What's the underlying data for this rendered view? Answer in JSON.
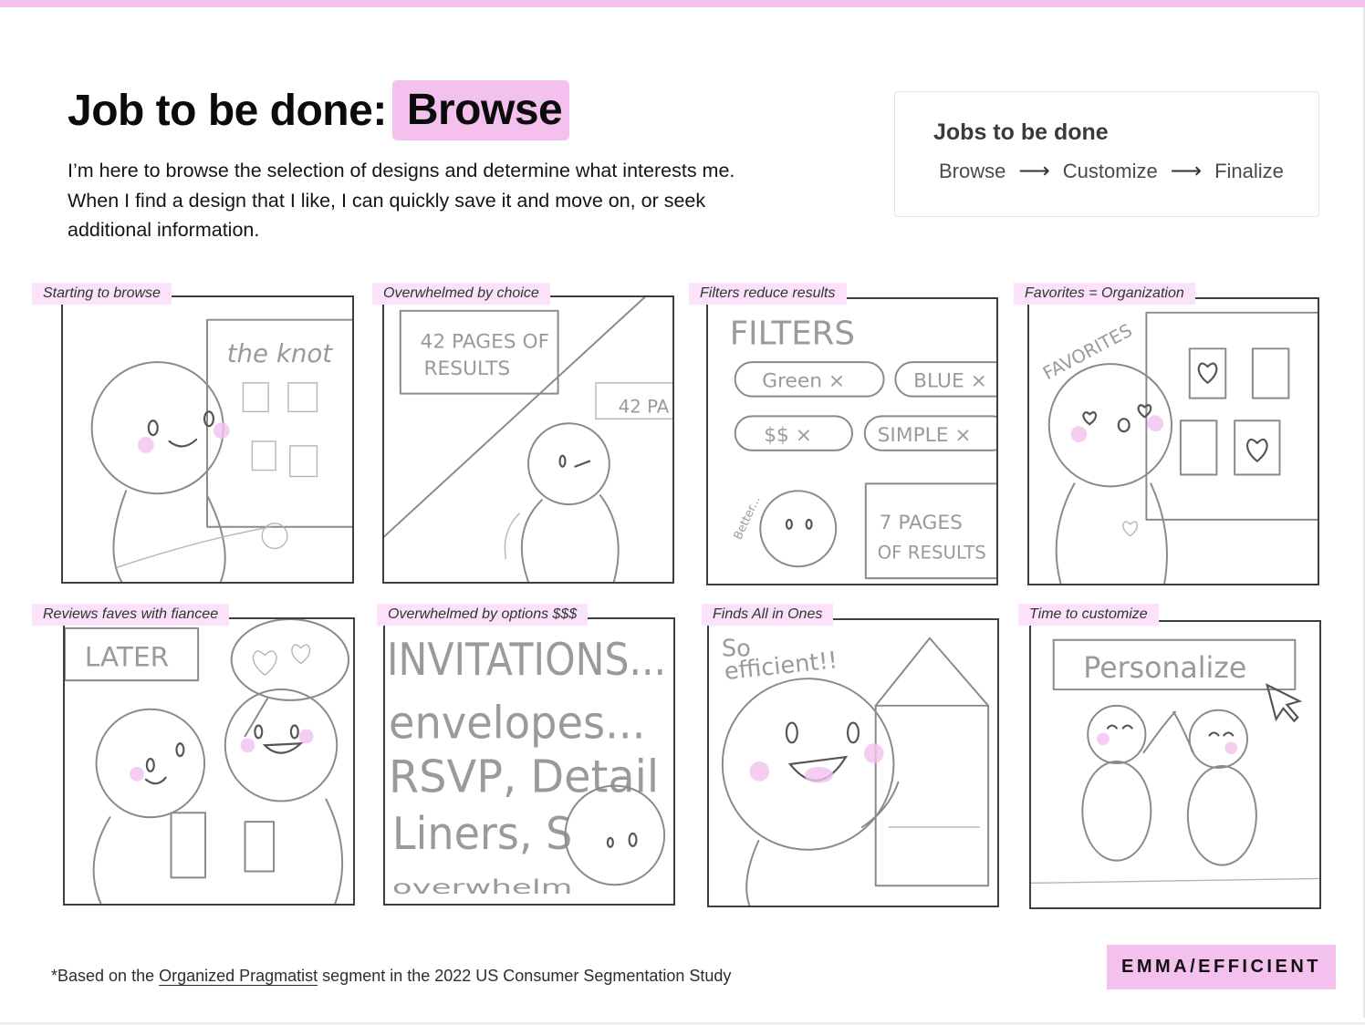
{
  "header": {
    "title_prefix": "Job to be done:",
    "title_highlight": "Browse",
    "description": "I’m here to browse the selection of designs and determine what interests me. When I find a design that I like, I can quickly save it and move on, or seek additional information."
  },
  "jobs_card": {
    "title": "Jobs to be done",
    "steps": [
      "Browse",
      "Customize",
      "Finalize"
    ],
    "arrow": "⟶"
  },
  "panels": [
    {
      "label": "Starting to browse",
      "sketch_text": [
        "the knot"
      ]
    },
    {
      "label": "Overwhelmed by choice",
      "sketch_text": [
        "42 PAGES OF",
        "RESULTS",
        "42 PA"
      ]
    },
    {
      "label": "Filters reduce results",
      "sketch_text": [
        "FILTERS",
        "Green ×",
        "BLUE ×",
        "$$ ×",
        "SIMPLE ×",
        "Better...",
        "7 PAGES",
        "OF RESULTS"
      ]
    },
    {
      "label": "Favorites = Organization",
      "sketch_text": [
        "FAVORITES"
      ]
    },
    {
      "label": "Reviews faves with fiancee",
      "sketch_text": [
        "LATER"
      ]
    },
    {
      "label": "Overwhelmed by options $$$",
      "sketch_text": [
        "INVITATIONS...",
        "envelopes...",
        "RSVP, Detail",
        "Liners, S",
        "overwhelm"
      ]
    },
    {
      "label": "Finds All in Ones",
      "sketch_text": [
        "So",
        "efficient!!"
      ]
    },
    {
      "label": "Time to customize",
      "sketch_text": [
        "Personalize"
      ]
    }
  ],
  "footer": {
    "footnote_prefix": "*Based on the ",
    "footnote_link": "Organized Pragmatist",
    "footnote_suffix": " segment in the 2022 US Consumer Segmentation Study",
    "brand": "EMMA/EFFICIENT"
  },
  "colors": {
    "accent_pink": "#f4c1ef",
    "label_pink": "#fbe1f9",
    "pencil": "#8a8a8a"
  }
}
